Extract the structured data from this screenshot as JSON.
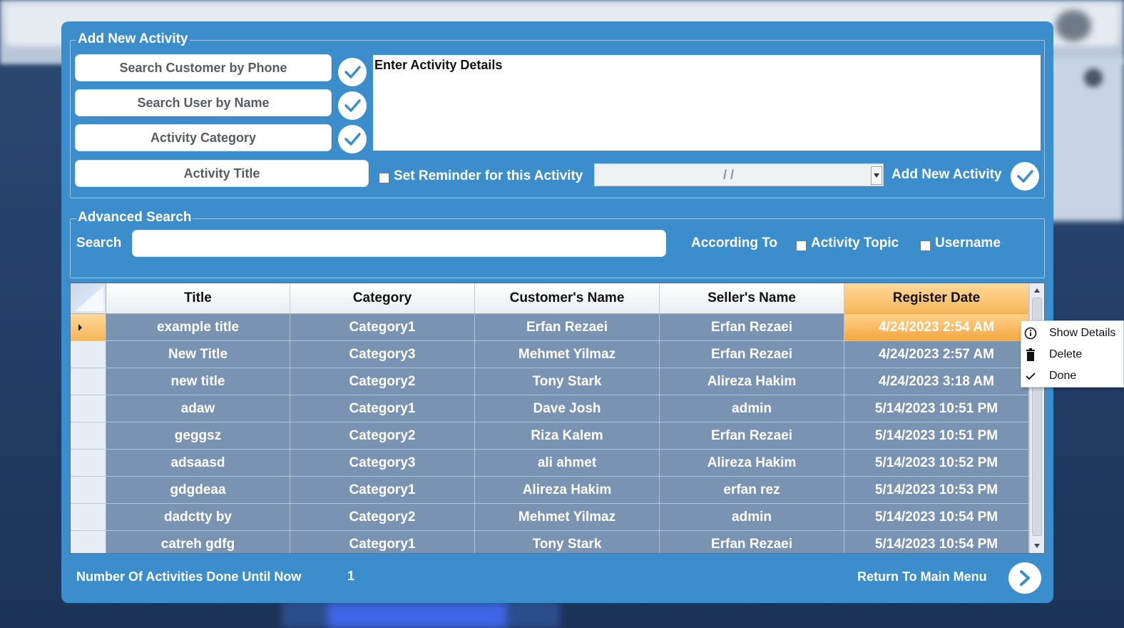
{
  "window": {
    "accent_color": "#3b8dcb",
    "row_color": "#7a93b3",
    "highlight_color": "#f6b75a"
  },
  "add_activity": {
    "legend": "Add New Activity",
    "search_customer_label": "Search Customer by Phone",
    "search_user_label": "Search User by Name",
    "category_label": "Activity Category",
    "title_label": "Activity Title",
    "details_placeholder": "Enter Activity Details",
    "reminder_label": "Set Reminder for this Activity",
    "reminder_checked": false,
    "date_value": "/  /",
    "add_button_label": "Add New Activity",
    "icons": {
      "confirm": "check-circle-icon",
      "dropdown": "chevron-down-icon"
    }
  },
  "advanced_search": {
    "legend": "Advanced Search",
    "search_label": "Search",
    "search_value": "",
    "according_to_label": "According To",
    "activity_topic_label": "Activity Topic",
    "activity_topic_checked": false,
    "username_label": "Username",
    "username_checked": false
  },
  "grid": {
    "columns": [
      "Title",
      "Category",
      "Customer's Name",
      "Seller's Name",
      "Register Date"
    ],
    "selected_column": "Register Date",
    "selected_row": 0,
    "rows": [
      [
        "example title",
        "Category1",
        "Erfan Rezaei",
        "Erfan Rezaei",
        "4/24/2023 2:54 AM"
      ],
      [
        "New Title",
        "Category3",
        "Mehmet Yilmaz",
        "Erfan Rezaei",
        "4/24/2023 2:57 AM"
      ],
      [
        "new title",
        "Category2",
        "Tony Stark",
        "Alireza Hakim",
        "4/24/2023 3:18 AM"
      ],
      [
        "adaw",
        "Category1",
        "Dave Josh",
        "admin",
        "5/14/2023 10:51 PM"
      ],
      [
        "geggsz",
        "Category2",
        "Riza Kalem",
        "Erfan Rezaei",
        "5/14/2023 10:51 PM"
      ],
      [
        "adsaasd",
        "Category3",
        "ali ahmet",
        "Alireza Hakim",
        "5/14/2023 10:52 PM"
      ],
      [
        "gdgdeaa",
        "Category1",
        "Alireza Hakim",
        "erfan rez",
        "5/14/2023 10:53 PM"
      ],
      [
        "dadctty by",
        "Category2",
        "Mehmet Yilmaz",
        "admin",
        "5/14/2023 10:54 PM"
      ],
      [
        "catreh gdfg",
        "Category1",
        "Tony Stark",
        "Erfan Rezaei",
        "5/14/2023 10:54 PM"
      ]
    ]
  },
  "footer": {
    "done_count_label": "Number Of Activities Done Until Now",
    "done_count_value": "1",
    "return_label": "Return To Main Menu",
    "return_icon": "chevron-right-icon"
  },
  "context_menu": {
    "items": [
      {
        "label": "Show Details",
        "icon": "info-icon"
      },
      {
        "label": "Delete",
        "icon": "trash-icon"
      },
      {
        "label": "Done",
        "icon": "checkmark-icon"
      }
    ]
  }
}
